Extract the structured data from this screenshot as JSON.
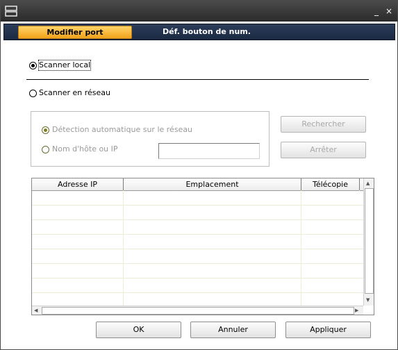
{
  "window": {
    "minimize_glyph": "_",
    "close_glyph": "×"
  },
  "tabs": [
    {
      "label": "Modifier port"
    },
    {
      "label": "Déf. bouton de num."
    }
  ],
  "scanner_local": {
    "label": "Scanner local",
    "selected": true
  },
  "scanner_reseau": {
    "label": "Scanner en réseau",
    "selected": false
  },
  "network": {
    "auto_detect_label": "Détection automatique sur le réseau",
    "hostname_label": "Nom d'hôte ou IP",
    "hostname_value": "",
    "search_button": "Rechercher",
    "stop_button": "Arrêter"
  },
  "grid": {
    "columns": [
      "Adresse IP",
      "Emplacement",
      "Télécopie"
    ],
    "rows": []
  },
  "footer": {
    "ok": "OK",
    "cancel": "Annuler",
    "apply": "Appliquer"
  }
}
